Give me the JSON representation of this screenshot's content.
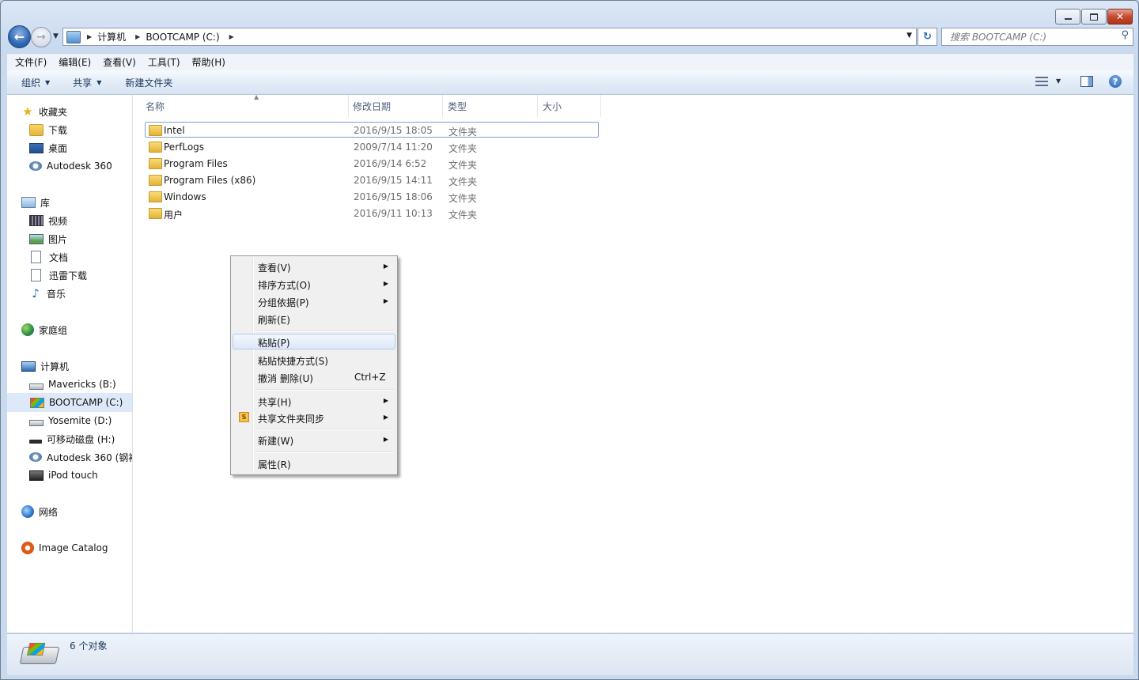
{
  "window": {
    "controls": {
      "minimize": "minimize-icon",
      "maximize": "maximize-icon",
      "close": "close-icon"
    }
  },
  "address": {
    "crumbs": [
      "计算机",
      "BOOTCAMP (C:)"
    ],
    "search_placeholder": "搜索 BOOTCAMP (C:)"
  },
  "menubar": [
    "文件(F)",
    "编辑(E)",
    "查看(V)",
    "工具(T)",
    "帮助(H)"
  ],
  "commandbar": {
    "organize": "组织",
    "share": "共享",
    "new_folder": "新建文件夹"
  },
  "navpane": {
    "favorites": {
      "label": "收藏夹",
      "items": [
        "下载",
        "桌面",
        "Autodesk 360"
      ]
    },
    "libraries": {
      "label": "库",
      "items": [
        "视频",
        "图片",
        "文档",
        "迅雷下载",
        "音乐"
      ]
    },
    "homegroup": "家庭组",
    "computer": {
      "label": "计算机",
      "items": [
        "Mavericks (B:)",
        "BOOTCAMP (C:)",
        "Yosemite (D:)",
        "可移动磁盘 (H:)",
        "Autodesk 360 (钢衬",
        "iPod touch"
      ]
    },
    "network": "网络",
    "image_catalog": "Image Catalog"
  },
  "columns": {
    "name": "名称",
    "date": "修改日期",
    "type": "类型",
    "size": "大小"
  },
  "files": [
    {
      "name": "Intel",
      "date": "2016/9/15 18:05",
      "type": "文件夹"
    },
    {
      "name": "PerfLogs",
      "date": "2009/7/14 11:20",
      "type": "文件夹"
    },
    {
      "name": "Program Files",
      "date": "2016/9/14 6:52",
      "type": "文件夹"
    },
    {
      "name": "Program Files (x86)",
      "date": "2016/9/15 14:11",
      "type": "文件夹"
    },
    {
      "name": "Windows",
      "date": "2016/9/15 18:06",
      "type": "文件夹"
    },
    {
      "name": "用户",
      "date": "2016/9/11 10:13",
      "type": "文件夹"
    }
  ],
  "context_menu": {
    "view": "查看(V)",
    "sort": "排序方式(O)",
    "group": "分组依据(P)",
    "refresh": "刷新(E)",
    "paste": "粘贴(P)",
    "paste_shortcut": "粘贴快捷方式(S)",
    "undo_delete": "撤消 删除(U)",
    "undo_shortcut": "Ctrl+Z",
    "share": "共享(H)",
    "share_sync": "共享文件夹同步",
    "new": "新建(W)",
    "properties": "属性(R)"
  },
  "status": {
    "count": "6 个对象"
  }
}
